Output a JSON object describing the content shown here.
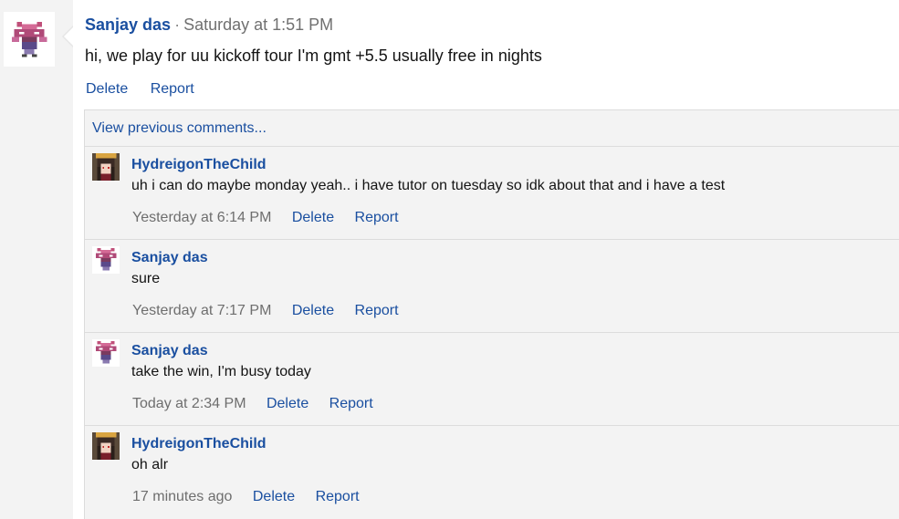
{
  "post": {
    "author": "Sanjay das",
    "separator": "·",
    "time": "Saturday at 1:51 PM",
    "text": "hi, we play for uu kickoff tour I'm gmt +5.5 usually free in nights",
    "actions": {
      "delete": "Delete",
      "report": "Report"
    },
    "avatar_icon": "pixel-sprite-avatar"
  },
  "comments_section": {
    "view_previous": "View previous comments...",
    "items": [
      {
        "author": "HydreigonTheChild",
        "text": "uh i can do maybe monday yeah.. i have tutor on tuesday so idk about that and i have a test",
        "time": "Yesterday at 6:14 PM",
        "delete": "Delete",
        "report": "Report",
        "avatar_icon": "anime-character-avatar"
      },
      {
        "author": "Sanjay das",
        "text": "sure",
        "time": "Yesterday at 7:17 PM",
        "delete": "Delete",
        "report": "Report",
        "avatar_icon": "pixel-sprite-avatar"
      },
      {
        "author": "Sanjay das",
        "text": "take the win, I'm busy today",
        "time": "Today at 2:34 PM",
        "delete": "Delete",
        "report": "Report",
        "avatar_icon": "pixel-sprite-avatar"
      },
      {
        "author": "HydreigonTheChild",
        "text": "oh alr",
        "time": "17 minutes ago",
        "delete": "Delete",
        "report": "Report",
        "avatar_icon": "anime-character-avatar"
      }
    ]
  },
  "colors": {
    "link": "#1a4fa0",
    "meta_text": "#6e6e6e",
    "panel_bg": "#f3f3f3",
    "border": "#dcdcdc"
  }
}
